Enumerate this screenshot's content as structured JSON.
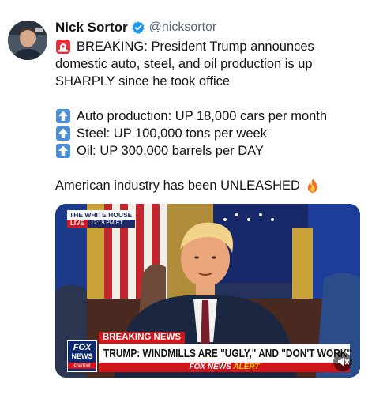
{
  "tweet": {
    "author": {
      "display_name": "Nick Sortor",
      "handle": "@nicksortor",
      "verified": true
    },
    "lines": {
      "l1": "BREAKING: President Trump announces",
      "l2": "domestic auto, steel, and oil production is up",
      "l3": "SHARPLY since he took office",
      "l4": "Auto production: UP 18,000 cars per month",
      "l5": "Steel: UP 100,000 tons per week",
      "l6": "Oil: UP 300,000 barrels per DAY",
      "l7": "American industry has been UNLEASHED"
    },
    "emojis": {
      "siren": "police-car-light-icon",
      "arrow": "up-arrow-icon",
      "fire": "fire-icon"
    }
  },
  "media": {
    "channel_tag": "THE WHITE HOUSE",
    "live_label": "LIVE",
    "time_label": "12:19 PM ET",
    "breaking_label": "BREAKING NEWS",
    "headline": "TRUMP: WINDMILLS ARE \"UGLY,\" AND \"DON'T WORK\"",
    "alert_prefix": "FOX NEWS",
    "alert_word": "ALERT",
    "logo_fox": "FOX",
    "logo_news": "NEWS",
    "logo_channel": "channel"
  },
  "colors": {
    "verified_badge": "#1d9bf0",
    "handle_gray": "#536471",
    "fox_red": "#d0161b",
    "fox_blue": "#0e2a6e"
  }
}
